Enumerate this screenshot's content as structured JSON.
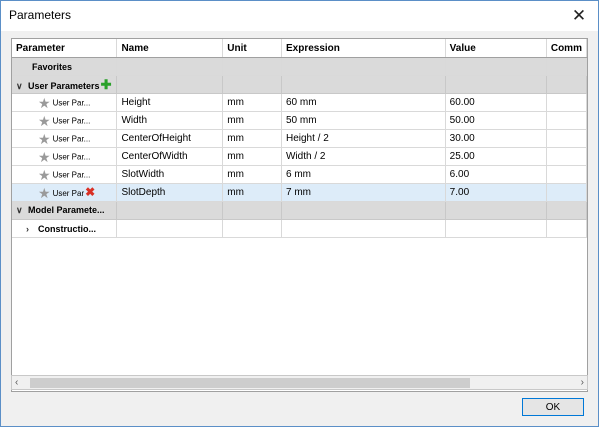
{
  "window": {
    "title": "Parameters",
    "close_glyph": "✕"
  },
  "columns": [
    "Parameter",
    "Name",
    "Unit",
    "Expression",
    "Value",
    "Comm"
  ],
  "favorites_label": "Favorites",
  "user_group": {
    "label": "User Parameters",
    "caret": "∨"
  },
  "user_params": [
    {
      "type": "User Par...",
      "name": "Height",
      "unit": "mm",
      "expression": "60 mm",
      "value": "60.00"
    },
    {
      "type": "User Par...",
      "name": "Width",
      "unit": "mm",
      "expression": "50 mm",
      "value": "50.00"
    },
    {
      "type": "User Par...",
      "name": "CenterOfHeight",
      "unit": "mm",
      "expression": "Height / 2",
      "value": "30.00"
    },
    {
      "type": "User Par...",
      "name": "CenterOfWidth",
      "unit": "mm",
      "expression": "Width / 2",
      "value": "25.00"
    },
    {
      "type": "User Par...",
      "name": "SlotWidth",
      "unit": "mm",
      "expression": "6 mm",
      "value": "6.00"
    },
    {
      "type": "User Par",
      "name": "SlotDepth",
      "unit": "mm",
      "expression": "7 mm",
      "value": "7.00"
    }
  ],
  "model_group": {
    "label": "Model Paramete...",
    "caret": "∨"
  },
  "construction": {
    "label": "Constructio...",
    "caret": "›"
  },
  "scroll": {
    "left": "‹",
    "right": "›"
  },
  "ok_label": "OK",
  "icons": {
    "star": "star-icon",
    "add": "plus-icon",
    "delete": "x-icon"
  },
  "colors": {
    "selected_row": "#ddecf9",
    "group_bg": "#dadada",
    "add_green": "#2aa12a",
    "delete_red": "#d93025",
    "ok_border": "#0078d7"
  }
}
